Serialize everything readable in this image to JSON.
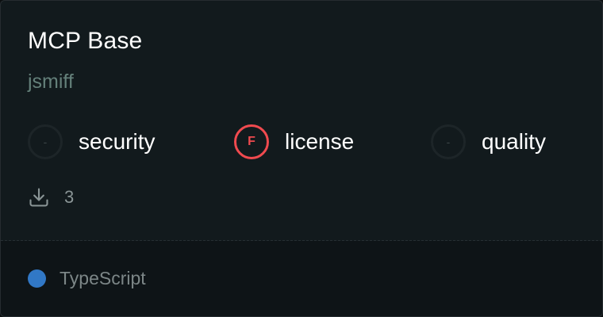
{
  "card": {
    "title": "MCP Base",
    "author": "jsmiff"
  },
  "scores": [
    {
      "symbol": "-",
      "label": "security",
      "state": "empty"
    },
    {
      "symbol": "F",
      "label": "license",
      "state": "fail",
      "color": "#f04a4f"
    },
    {
      "symbol": "-",
      "label": "quality",
      "state": "empty"
    }
  ],
  "downloads": {
    "icon": "download-icon",
    "count": "3"
  },
  "language": {
    "name": "TypeScript",
    "color": "#3178c6"
  }
}
